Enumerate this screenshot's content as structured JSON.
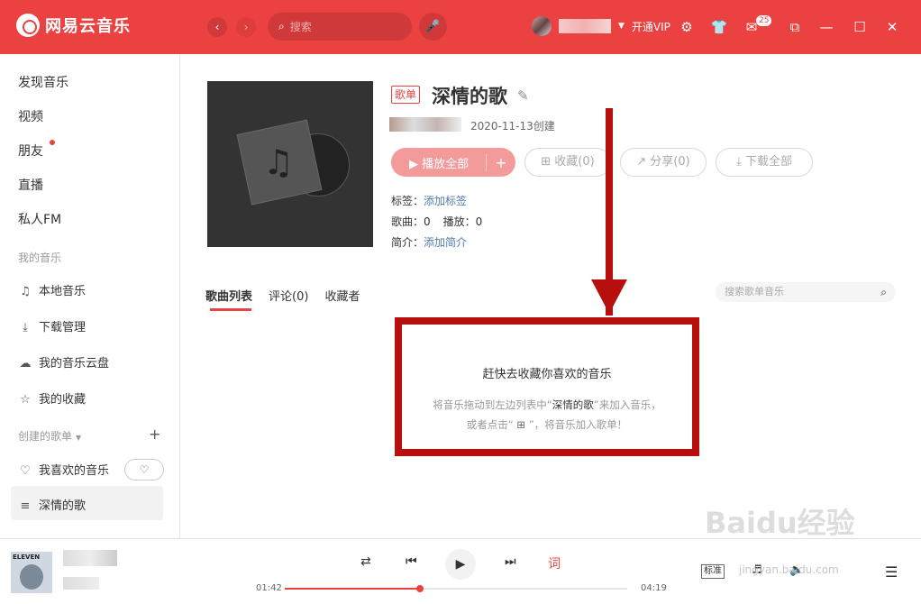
{
  "app": {
    "name": "网易云音乐"
  },
  "topbar": {
    "search_placeholder": "搜索",
    "vip_label": "开通VIP",
    "mail_badge": "25",
    "back_icon": "chevron-left-icon",
    "forward_icon": "chevron-right-icon"
  },
  "sidebar": {
    "main_items": [
      "发现音乐",
      "视频",
      "朋友",
      "直播",
      "私人FM"
    ],
    "my_music_heading": "我的音乐",
    "my_music_items": [
      "本地音乐",
      "下载管理",
      "我的音乐云盘",
      "我的收藏"
    ],
    "created_heading": "创建的歌单",
    "created_items": [
      "我喜欢的音乐",
      "深情的歌"
    ]
  },
  "playlist": {
    "type_tag": "歌单",
    "title": "深情的歌",
    "created_date": "2020-11-13创建",
    "play_all": "播放全部",
    "collect": "收藏(0)",
    "share": "分享(0)",
    "download_all": "下载全部",
    "tags_label": "标签：",
    "tags_link": "添加标签",
    "songs_label": "歌曲：0",
    "plays_label": "播放：0",
    "intro_label": "简介：",
    "intro_link": "添加简介"
  },
  "tabs": [
    "歌曲列表",
    "评论(0)",
    "收藏者"
  ],
  "playlist_search_placeholder": "搜索歌单音乐",
  "empty": {
    "title": "赶快去收藏你喜欢的音乐",
    "line1_pre": "将音乐拖动到左边列表中“",
    "line1_name": "深情的歌",
    "line1_post": "”来加入音乐，",
    "line2_pre": "或者点击“",
    "line2_post": "”，将音乐加入歌单！"
  },
  "player": {
    "album_text": "ELEVEN",
    "current_time": "01:42",
    "total_time": "04:19",
    "progress": 0.395,
    "quality": "标准"
  },
  "watermark": {
    "text": "Baidu经验",
    "sub": "jingyan.baidu.com"
  },
  "colors": {
    "brand": "#ec4141",
    "annotation": "#b70e0e",
    "link": "#507daf"
  }
}
